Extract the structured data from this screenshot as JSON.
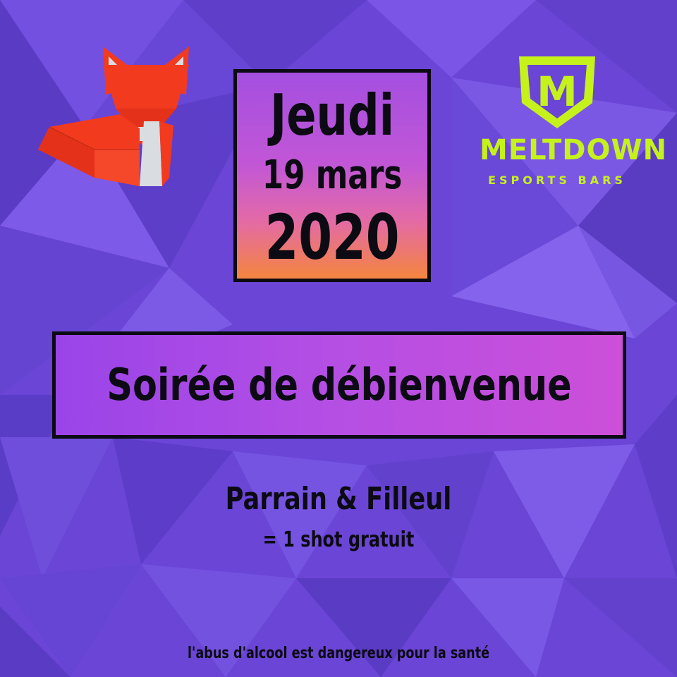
{
  "colors": {
    "background": "#6a45d6",
    "fox_red": "#f23a1e",
    "fox_white": "#d9dde2",
    "logo_green": "#c6f21c",
    "text_dark": "#0c0a12"
  },
  "icons": {
    "fox": "origami-fox-icon",
    "logo_shield": "meltdown-shield-icon"
  },
  "logo": {
    "shield_letter": "M",
    "wordmark": "MELTDOWN",
    "subtitle": "ESPORTS BARS"
  },
  "date": {
    "day": "Jeudi",
    "month": "19 mars",
    "year": "2020"
  },
  "event": {
    "title": "Soirée de débienvenue"
  },
  "offer": {
    "line1": "Parrain & Filleul",
    "line2": "= 1 shot gratuit"
  },
  "footer": {
    "disclaimer": "l'abus d'alcool est dangereux pour la santé"
  }
}
